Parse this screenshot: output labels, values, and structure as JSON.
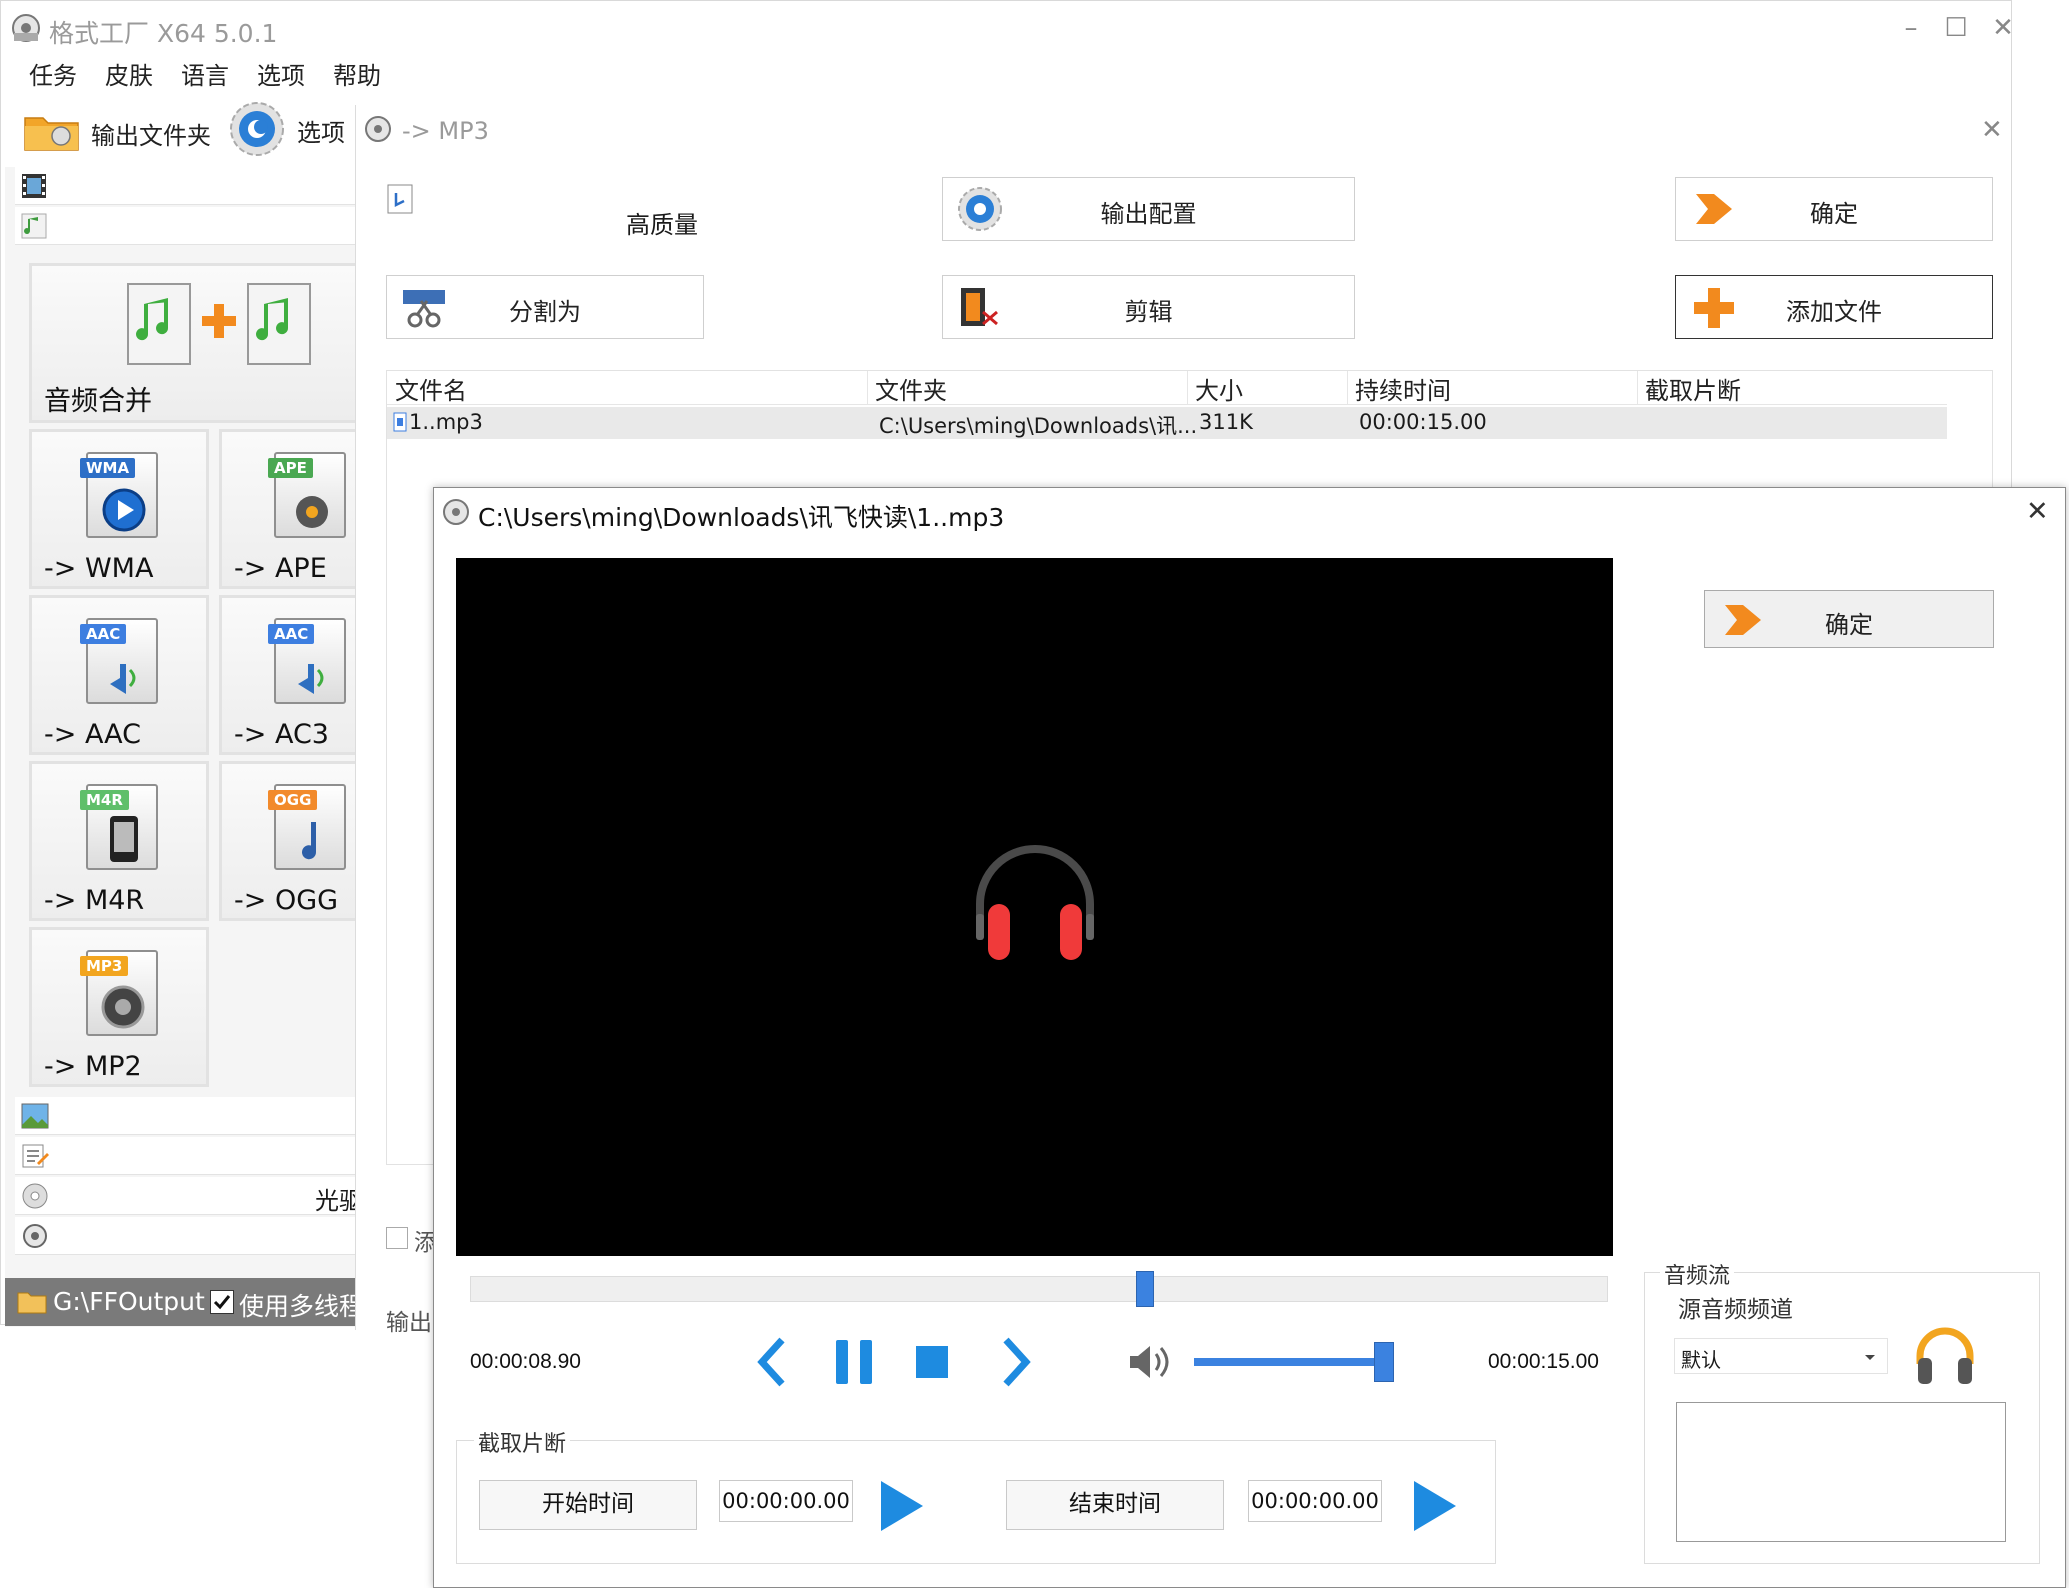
{
  "window": {
    "title": "格式工厂 X64 5.0.1",
    "minimize": "–",
    "maximize": "☐",
    "close": "✕"
  },
  "menu": [
    "任务",
    "皮肤",
    "语言",
    "选项",
    "帮助"
  ],
  "toolbar": {
    "output_folder": "输出文件夹",
    "options": "选项"
  },
  "sidebar": {
    "merge_label": "音频合并",
    "tiles": [
      {
        "badge": "WMA",
        "label": "-> WMA",
        "badge_color": "#2d6fc7"
      },
      {
        "badge": "APE",
        "label": "-> APE",
        "badge_color": "#4aa852"
      },
      {
        "badge": "AAC",
        "label": "-> AAC",
        "badge_color": "#3d7ee0"
      },
      {
        "badge": "AAC",
        "label": "-> AC3",
        "badge_color": "#3d7ee0"
      },
      {
        "badge": "M4R",
        "label": "-> M4R",
        "badge_color": "#5fbf6a"
      },
      {
        "badge": "OGG",
        "label": "-> OGG",
        "badge_color": "#f28a2b"
      },
      {
        "badge": "MP3",
        "label": "-> MP2",
        "badge_color": "#f2a51f"
      }
    ],
    "disc_label": "光驱"
  },
  "status": {
    "output_path": "G:\\FFOutput",
    "multithread_label": "使用多线程"
  },
  "mp3_dialog": {
    "title": "-> MP3",
    "quality": "高质量",
    "output_config": "输出配置",
    "ok": "确定",
    "split": "分割为",
    "clip": "剪辑",
    "add_file": "添加文件",
    "columns": [
      "文件名",
      "文件夹",
      "大小",
      "持续时间",
      "截取片断"
    ],
    "rows": [
      {
        "name": "1..mp3",
        "folder": "C:\\Users\\ming\\Downloads\\讯...",
        "size": "311K",
        "duration": "00:00:15.00",
        "clip": ""
      }
    ],
    "partial_checkbox": "添",
    "partial_output": "输出"
  },
  "player": {
    "title": "C:\\Users\\ming\\Downloads\\讯飞快读\\1..mp3",
    "close": "✕",
    "ok": "确定",
    "current_time": "00:00:08.90",
    "total_time": "00:00:15.00",
    "seek_position": 0.593,
    "volume_level": 1.0,
    "clip_group": "截取片断",
    "start_time_btn": "开始时间",
    "start_time_value": "00:00:00.00",
    "end_time_btn": "结束时间",
    "end_time_value": "00:00:00.00",
    "audio_stream_group": "音频流",
    "source_channel_label": "源音频频道",
    "channel_value": "默认"
  }
}
